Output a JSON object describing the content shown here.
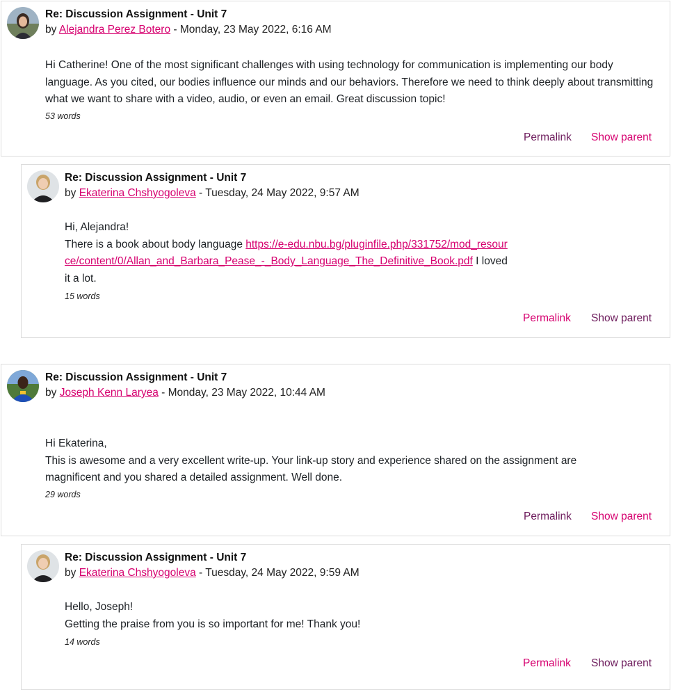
{
  "colors": {
    "link": "#d6006f",
    "command_dark": "#6c1a5b",
    "border": "#dcdcdc"
  },
  "posts": [
    {
      "subject": "Re: Discussion Assignment - Unit 7",
      "by": "by ",
      "author": "Alejandra Perez Botero",
      "date": " - Monday, 23 May 2022, 6:16 AM",
      "body": [
        "Hi Catherine! One of the most significant challenges with using technology for communication is implementing our body language. As you cited, our bodies influence our minds and our behaviors. Therefore we need to think deeply about transmitting what we want to share with a video, audio, or even an email. Great discussion topic!"
      ],
      "word_count": "53 words",
      "permalink": "Permalink",
      "show_parent": "Show parent"
    },
    {
      "subject": "Re: Discussion Assignment - Unit 7",
      "by": "by ",
      "author": "Ekaterina Chshyogoleva",
      "date": " - Tuesday, 24 May 2022, 9:57 AM",
      "greeting": "Hi, Alejandra!",
      "text_before_link": "There is a book about body language ",
      "link": "https://e-edu.nbu.bg/pluginfile.php/331752/mod_resource/content/0/Allan_and_Barbara_Pease_-_Body_Language_The_Definitive_Book.pdf",
      "text_after_link": " I loved it a lot.",
      "word_count": "15 words",
      "permalink": "Permalink",
      "show_parent": "Show parent"
    },
    {
      "subject": "Re: Discussion Assignment - Unit 7",
      "by": "by ",
      "author": "Joseph Kenn Laryea",
      "date": " - Monday, 23 May 2022, 10:44 AM",
      "body": [
        "Hi Ekaterina,",
        "This is awesome and a very excellent write-up. Your link-up story and experience shared on the assignment are magnificent and you shared a detailed assignment. Well done."
      ],
      "word_count": "29 words",
      "permalink": "Permalink",
      "show_parent": "Show parent"
    },
    {
      "subject": "Re: Discussion Assignment - Unit 7",
      "by": "by ",
      "author": "Ekaterina Chshyogoleva",
      "date": " - Tuesday, 24 May 2022, 9:59 AM",
      "body": [
        "Hello, Joseph!",
        "Getting the praise from you is so important for me! Thank you!"
      ],
      "word_count": "14 words",
      "permalink": "Permalink",
      "show_parent": "Show parent"
    }
  ]
}
